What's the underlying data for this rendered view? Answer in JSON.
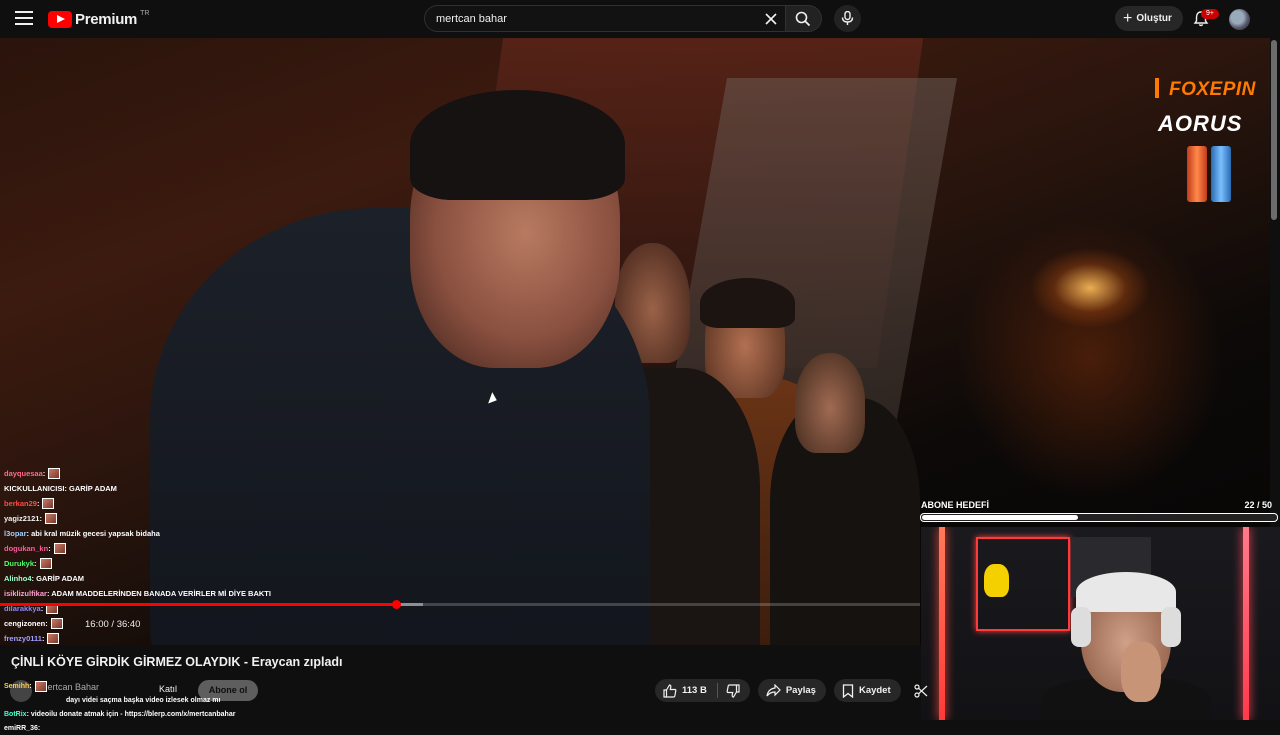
{
  "header": {
    "logo_text": "Premium",
    "logo_region": "TR",
    "search_value": "mertcan bahar",
    "create_label": "Oluştur",
    "notifications_badge": "9+"
  },
  "video": {
    "current_time": "16:00",
    "duration": "36:40",
    "time_display": "16:00 / 36:40",
    "progress_played": 0.43,
    "progress_loaded": 0.46,
    "title": "ÇİNLİ KÖYE GİRDİK GİRMEZ OLAYDIK - Eraycan zıpladı"
  },
  "sponsors": {
    "foxepin": "FOXEPIN",
    "aorus": "AORUS"
  },
  "channel": {
    "name": "Mertcan Bahar",
    "join_label": "Katıl",
    "subscribe_label": "Abone ol"
  },
  "actions": {
    "likes": "113 B",
    "share_label": "Paylaş",
    "save_label": "Kaydet"
  },
  "sub_goal": {
    "title": "ABONE HEDEFİ",
    "current": 22,
    "target": 50,
    "count_text": "22  / 50"
  },
  "chat": [
    {
      "user": "dayquesaa",
      "color": "#ff6a8a",
      "msg": "",
      "emote": true
    },
    {
      "user": "KICKULLANICISI",
      "color": "#ffffff",
      "msg": " : GARİP ADAM",
      "emote": false
    },
    {
      "user": "berkan29",
      "color": "#ff4a4a",
      "msg": "",
      "emote": true
    },
    {
      "user": "yagiz2121",
      "color": "#f0f0f0",
      "msg": "",
      "emote": true
    },
    {
      "user": "l3opar",
      "color": "#a0d0ff",
      "msg": " : abi kral müzik gecesi yapsak bidaha",
      "emote": false
    },
    {
      "user": "dogukan_kn",
      "color": "#ff5aa0",
      "msg": "",
      "emote": true
    },
    {
      "user": "Durukyk",
      "color": "#4aff6a",
      "msg": "",
      "emote": true
    },
    {
      "user": "Alinho4",
      "color": "#a0ffd0",
      "msg": " : GARİP ADAM",
      "emote": false
    },
    {
      "user": "isiklizulfikar",
      "color": "#ffa0d0",
      "msg": " : ADAM MADDELERİNDEN BANADA VERİRLER Mİ DİYE BAKTI",
      "emote": false
    },
    {
      "user": "dilarakkya",
      "color": "#8a8aff",
      "msg": "",
      "emote": true
    },
    {
      "user": "cengizonen",
      "color": "#ffffff",
      "msg": "",
      "emote": true
    },
    {
      "user": "frenzy0111",
      "color": "#a0a0ff",
      "msg": "",
      "emote": true
    }
  ],
  "chat_bottom": [
    {
      "user": "Semihh",
      "color": "#ffd04a",
      "msg": "",
      "emote": true
    },
    {
      "user": "",
      "color": "#ffffff",
      "msg": "dayı videi saçma başka video izlesek olmaz mı",
      "emote": false
    },
    {
      "user": "BotRix",
      "color": "#4affd0",
      "msg": " : videoilu donate atmak için - https://blerp.com/x/mertcanbahar",
      "emote": false
    },
    {
      "user": "emiRR_36",
      "color": "#ffffff",
      "msg": " :",
      "emote": false
    }
  ]
}
